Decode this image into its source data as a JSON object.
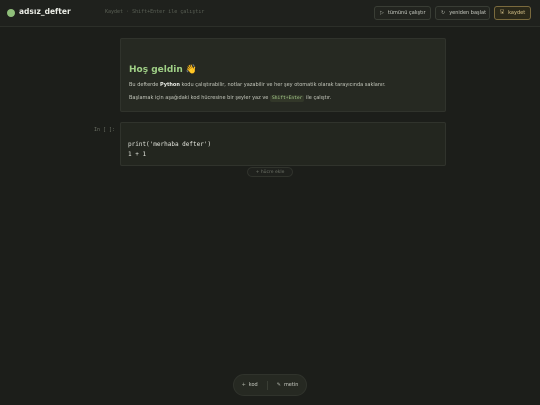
{
  "app": {
    "title": "adsız_defter",
    "hint": "Kaydet · Shift+Enter ile çalıştır"
  },
  "toolbar": {
    "run_all_label": "tümünü çalıştır",
    "run_all_icon": "▷",
    "restart_label": "yeniden başlat",
    "restart_icon": "↻",
    "save_label": "kaydet",
    "save_icon": "🖫"
  },
  "markdown_cell": {
    "title": "Hoş geldin",
    "title_emoji": "👋",
    "p1_prefix": "Bu defterde ",
    "p1_bold": "Python",
    "p1_suffix": " kodu çalıştırabilir, notlar yazabilir ve her şey otomatik olarak tarayıcında saklanır.",
    "p2_prefix": "Başlamak için aşağıdaki kod hücresine bir şeyler yaz ve ",
    "p2_kbd": "Shift+Enter",
    "p2_suffix": " ile çalıştır."
  },
  "code_cell": {
    "prompt": "In [ ]:",
    "lines": [
      "print('merhaba defter')",
      "1 + 1"
    ]
  },
  "add_cell": {
    "label": "+ hücre ekle"
  },
  "bottom_bar": {
    "code_label": "kod",
    "code_icon": "+",
    "text_label": "metin",
    "text_icon": "✎"
  },
  "colors": {
    "background": "#1c1e1a",
    "accent_green": "#9fcf86",
    "save_accent": "#d8c48a"
  }
}
